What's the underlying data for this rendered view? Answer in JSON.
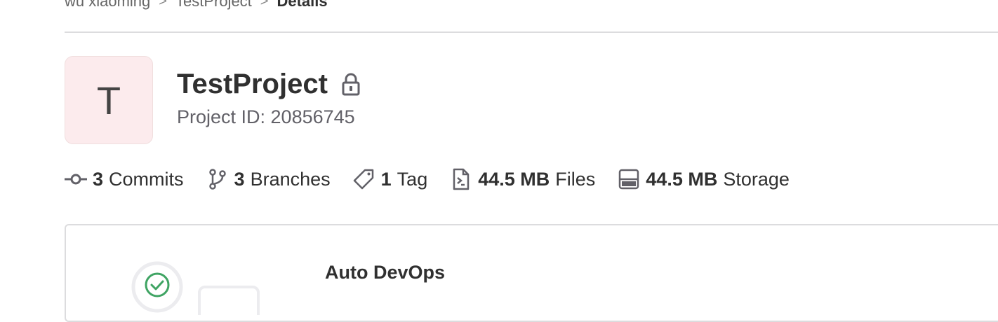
{
  "breadcrumb": {
    "items": [
      "wu xiaoming",
      "TestProject",
      "Details"
    ],
    "separator": ">"
  },
  "project": {
    "avatar_letter": "T",
    "avatar_bg": "#fcebed",
    "title": "TestProject",
    "visibility_icon": "lock-icon",
    "id_text": "Project ID: 20856745"
  },
  "stats": {
    "commits": {
      "count": "3",
      "label": "Commits",
      "icon": "commit-icon"
    },
    "branches": {
      "count": "3",
      "label": "Branches",
      "icon": "branch-icon"
    },
    "tags": {
      "count": "1",
      "label": "Tag",
      "icon": "tag-icon"
    },
    "files": {
      "count": "44.5 MB",
      "label": "Files",
      "icon": "file-icon"
    },
    "storage": {
      "count": "44.5 MB",
      "label": "Storage",
      "icon": "storage-icon"
    }
  },
  "auto_devops": {
    "title": "Auto DevOps",
    "accent_color": "#3fa463"
  }
}
